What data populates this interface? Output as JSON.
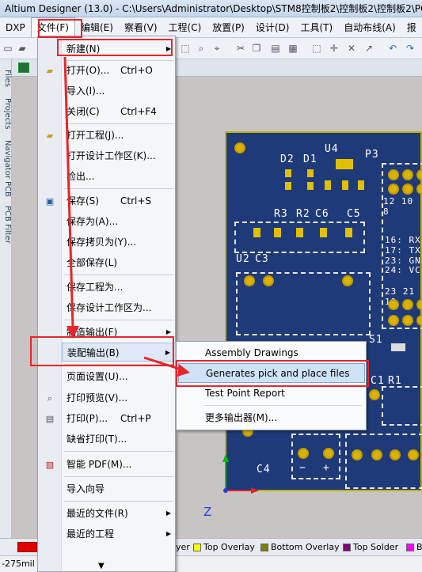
{
  "app": {
    "title": "Altium Designer (13.0) - C:\\Users\\Administrator\\Desktop\\STM8控制板2\\控制板2\\控制板2\\PC"
  },
  "menubar": {
    "items": [
      "DXP",
      "文件(F)",
      "编辑(E)",
      "察看(V)",
      "工程(C)",
      "放置(P)",
      "设计(D)",
      "工具(T)",
      "自动布线(A)",
      "报"
    ]
  },
  "dock_tabs": [
    "Files",
    "Projects",
    "Navigator",
    "PCB",
    "PCB Filter"
  ],
  "file_menu": {
    "items": [
      {
        "label": "新建(N)",
        "shortcut": "",
        "submenu": true
      },
      {
        "label": "打开(O)...",
        "shortcut": "Ctrl+O"
      },
      {
        "label": "导入(I)...",
        "shortcut": ""
      },
      {
        "label": "关闭(C)",
        "shortcut": "Ctrl+F4"
      },
      {
        "label": "打开工程(J)...",
        "shortcut": ""
      },
      {
        "label": "打开设计工作区(K)...",
        "shortcut": ""
      },
      {
        "label": "检出...",
        "shortcut": ""
      },
      {
        "label": "保存(S)",
        "shortcut": "Ctrl+S"
      },
      {
        "label": "保存为(A)...",
        "shortcut": ""
      },
      {
        "label": "保存拷贝为(Y)...",
        "shortcut": ""
      },
      {
        "label": "全部保存(L)",
        "shortcut": ""
      },
      {
        "label": "保存工程为...",
        "shortcut": ""
      },
      {
        "label": "保存设计工作区为...",
        "shortcut": ""
      },
      {
        "label": "制造输出(F)",
        "shortcut": "",
        "submenu": true
      },
      {
        "label": "装配输出(B)",
        "shortcut": "",
        "submenu": true
      },
      {
        "label": "页面设置(U)...",
        "shortcut": ""
      },
      {
        "label": "打印预览(V)...",
        "shortcut": ""
      },
      {
        "label": "打印(P)...",
        "shortcut": "Ctrl+P"
      },
      {
        "label": "缺省打印(T)...",
        "shortcut": ""
      },
      {
        "label": "智能 PDF(M)...",
        "shortcut": ""
      },
      {
        "label": "导入向导",
        "shortcut": ""
      },
      {
        "label": "最近的文件(R)",
        "shortcut": "",
        "submenu": true
      },
      {
        "label": "最近的工程",
        "shortcut": "",
        "submenu": true
      }
    ]
  },
  "assembly_submenu": {
    "items": [
      "Assembly Drawings",
      "Generates pick and place files",
      "Test Point Report",
      "更多输出器(M)..."
    ]
  },
  "pcb": {
    "designators": [
      "D2",
      "D1",
      "U4",
      "P3",
      "R3",
      "R2",
      "C6",
      "C5",
      "U2",
      "C3",
      "S1",
      "C1",
      "R1",
      "C4"
    ],
    "header_text": "12 10 8",
    "pin_rows": [
      "16: RX",
      "17: TX",
      "23: GN",
      "24: VC"
    ],
    "pin_numbers": "23 21 19"
  },
  "layer_tabs": [
    {
      "label": "yer",
      "color": "#f0f0f0"
    },
    {
      "label": "Top Overlay",
      "color": "#ffff00"
    },
    {
      "label": "Bottom Overlay",
      "color": "#808000"
    },
    {
      "label": "Top Solder",
      "color": "#800080"
    },
    {
      "label": "B",
      "color": "#ff00ff"
    }
  ],
  "status": {
    "text": "-275mil Y                                                         nap)"
  }
}
